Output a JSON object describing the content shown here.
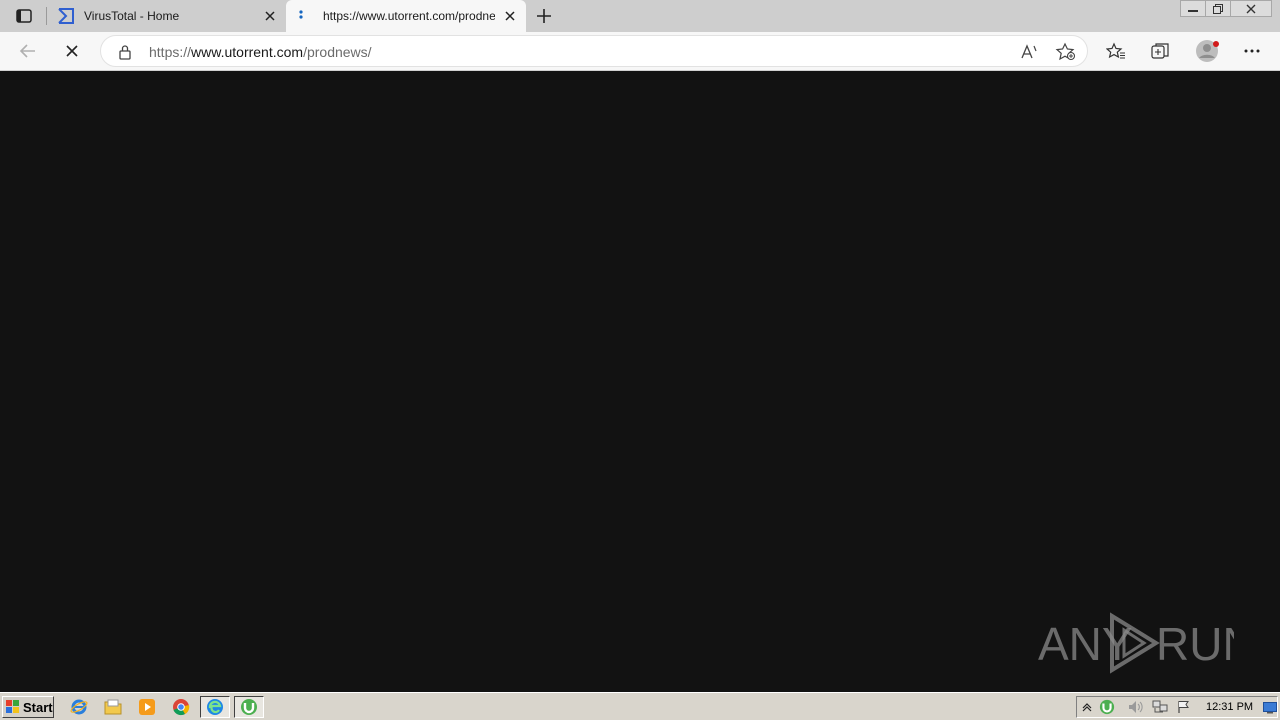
{
  "browser": {
    "tabs": [
      {
        "title": "VirusTotal - Home",
        "favicon": "virustotal-icon",
        "active": false
      },
      {
        "title": "https://www.utorrent.com/prodnews/",
        "favicon": "loading-icon",
        "active": true
      }
    ],
    "address": {
      "scheme": "https://",
      "host": "www.utorrent.com",
      "path": "/prodnews/"
    }
  },
  "watermark": {
    "text_left": "ANY",
    "text_right": "RUN"
  },
  "taskbar": {
    "start_label": "Start",
    "apps": [
      "ie-icon",
      "explorer-icon",
      "media-player-icon",
      "chrome-icon",
      "edge-icon",
      "utorrent-icon"
    ],
    "tray_icons": [
      "show-hidden-icon",
      "utorrent-tray-icon",
      "volume-icon",
      "network-icon",
      "flag-icon"
    ],
    "clock": "12:31 PM"
  },
  "colors": {
    "content_bg": "#121212",
    "tab_strip": "#cecece",
    "accent_blue": "#1565c0"
  }
}
